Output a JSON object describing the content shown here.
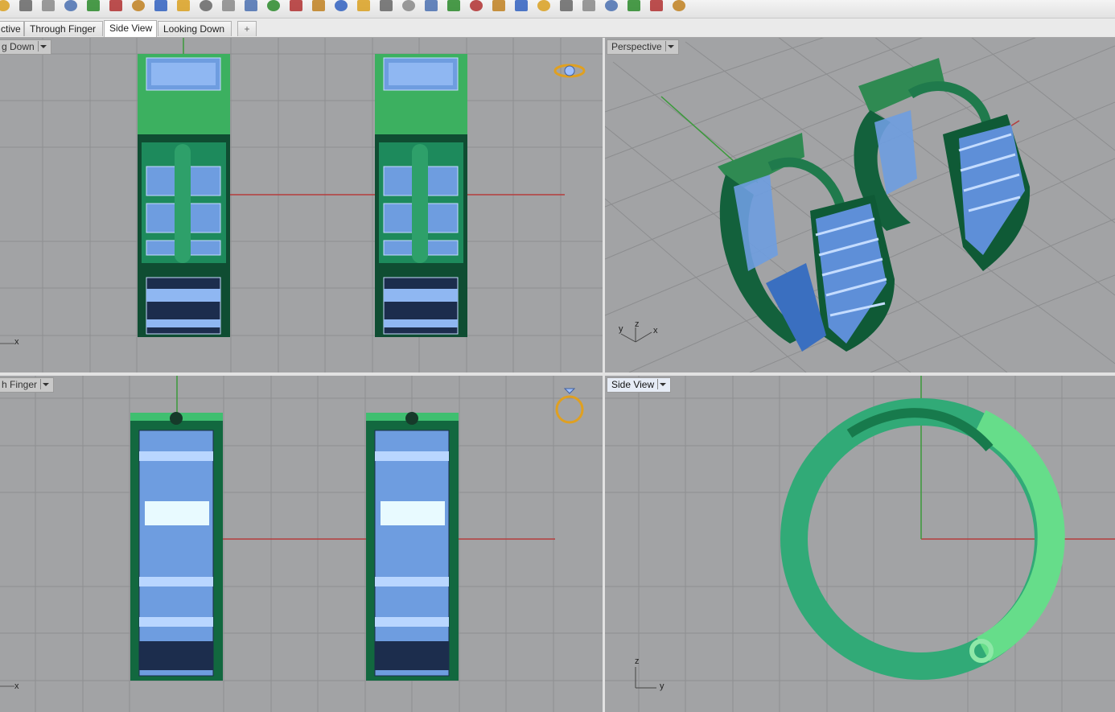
{
  "toolbar": {
    "icons": [
      "new-file-icon",
      "save-icon",
      "print-icon",
      "copy-page-icon",
      "cut-icon",
      "copy-icon",
      "paste-icon",
      "undo-icon",
      "redo-icon",
      "pan-icon",
      "rotate-icon",
      "zoom-icon",
      "zoom-window-icon",
      "zoom-extents-icon",
      "zoom-selected-icon",
      "zoom-target-icon",
      "four-view-icon",
      "car-render-icon",
      "properties-icon",
      "select-icon",
      "light-icon",
      "layer-icon",
      "material-icon",
      "color-wheel-icon",
      "render-sphere-icon",
      "shaded-sphere-icon",
      "blue-sphere-icon",
      "brush-icon",
      "settings-gear-icon",
      "dimension-icon",
      "help-icon"
    ]
  },
  "tabs": [
    {
      "label": "ctive",
      "active": false
    },
    {
      "label": "Through Finger",
      "active": false
    },
    {
      "label": "Side View",
      "active": true
    },
    {
      "label": "Looking Down",
      "active": false
    }
  ],
  "add_tab_label": "+",
  "viewports": {
    "top_left": {
      "label": "g Down",
      "axis_x": "x"
    },
    "top_right": {
      "label": "Perspective",
      "axis_y": "y",
      "axis_z": "z",
      "axis_x": "x"
    },
    "bottom_left": {
      "label": "h Finger",
      "axis_x": "x"
    },
    "bottom_right": {
      "label": "Side View",
      "axis_z": "z",
      "axis_y": "y"
    }
  },
  "colors": {
    "viewport_bg": "#a2a3a5",
    "grid_line": "#8f9092",
    "axis_x": "#b43c3c",
    "axis_y": "#3c8c3c",
    "metal_green": "#1e8a55",
    "metal_light": "#5ed08c",
    "gem_blue": "#7ea8e8"
  }
}
